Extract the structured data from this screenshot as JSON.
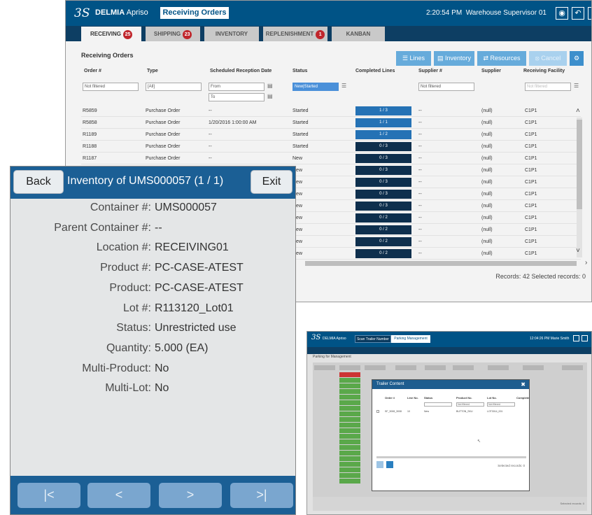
{
  "receiving": {
    "app": {
      "logo": "3S",
      "brand_bold": "DELMIA",
      "brand_rest": " Apriso",
      "page_tab": "Receiving Orders",
      "time": "2:20:54 PM",
      "user": "Warehouse Supervisor 01"
    },
    "tabs": [
      {
        "label": "RECEIVING",
        "badge": "25",
        "active": true
      },
      {
        "label": "SHIPPING",
        "badge": "23",
        "active": false
      },
      {
        "label": "INVENTORY",
        "badge": "",
        "active": false
      },
      {
        "label": "REPLENISHMENT",
        "badge": "1",
        "active": false
      },
      {
        "label": "KANBAN",
        "badge": "",
        "active": false
      }
    ],
    "title": "Receiving Orders",
    "toolbar": {
      "lines": "Lines",
      "inventory": "Inventory",
      "resources": "Resources",
      "cancel": "Cancel"
    },
    "columns": [
      "Order #",
      "Type",
      "Scheduled Reception Date",
      "Status",
      "Completed Lines",
      "Supplier #",
      "Supplier",
      "Receiving Facility"
    ],
    "filters": {
      "order": "Not filtered",
      "type": "[All]",
      "from": "From",
      "to": "To",
      "status": "New|Started",
      "supplier_no": "Not filtered",
      "facility": "Not filtered"
    },
    "rows": [
      {
        "order": "R5859",
        "type": "Purchase Order",
        "date": "--",
        "status": "Started",
        "lines": "1 / 3",
        "supplier_no": "--",
        "supplier": "(null)",
        "facility": "C1P1"
      },
      {
        "order": "R5858",
        "type": "Purchase Order",
        "date": "1/20/2016 1:00:00 AM",
        "status": "Started",
        "lines": "1 / 1",
        "supplier_no": "--",
        "supplier": "(null)",
        "facility": "C1P1"
      },
      {
        "order": "R1189",
        "type": "Purchase Order",
        "date": "--",
        "status": "Started",
        "lines": "1 / 2",
        "supplier_no": "--",
        "supplier": "(null)",
        "facility": "C1P1"
      },
      {
        "order": "R1188",
        "type": "Purchase Order",
        "date": "--",
        "status": "Started",
        "lines": "0 / 3",
        "supplier_no": "--",
        "supplier": "(null)",
        "facility": "C1P1"
      },
      {
        "order": "R1187",
        "type": "Purchase Order",
        "date": "--",
        "status": "New",
        "lines": "0 / 3",
        "supplier_no": "--",
        "supplier": "(null)",
        "facility": "C1P1"
      },
      {
        "order": "",
        "type": "",
        "date": "",
        "status": "New",
        "lines": "0 / 3",
        "supplier_no": "--",
        "supplier": "(null)",
        "facility": "C1P1"
      },
      {
        "order": "",
        "type": "",
        "date": "",
        "status": "New",
        "lines": "0 / 3",
        "supplier_no": "--",
        "supplier": "(null)",
        "facility": "C1P1"
      },
      {
        "order": "",
        "type": "",
        "date": "",
        "status": "New",
        "lines": "0 / 3",
        "supplier_no": "--",
        "supplier": "(null)",
        "facility": "C1P1"
      },
      {
        "order": "",
        "type": "",
        "date": "",
        "status": "New",
        "lines": "0 / 3",
        "supplier_no": "--",
        "supplier": "(null)",
        "facility": "C1P1"
      },
      {
        "order": "",
        "type": "",
        "date": "",
        "status": "New",
        "lines": "0 / 2",
        "supplier_no": "--",
        "supplier": "(null)",
        "facility": "C1P1"
      },
      {
        "order": "",
        "type": "",
        "date": "",
        "status": "New",
        "lines": "0 / 2",
        "supplier_no": "--",
        "supplier": "(null)",
        "facility": "C1P1"
      },
      {
        "order": "",
        "type": "",
        "date": "",
        "status": "New",
        "lines": "0 / 2",
        "supplier_no": "--",
        "supplier": "(null)",
        "facility": "C1P1"
      },
      {
        "order": "",
        "type": "",
        "date": "",
        "status": "New",
        "lines": "0 / 2",
        "supplier_no": "--",
        "supplier": "(null)",
        "facility": "C1P1"
      }
    ],
    "records": "Records: 42  Selected records: 0"
  },
  "inventory": {
    "back": "Back",
    "exit": "Exit",
    "title": "Inventory of UMS000057 (1 / 1)",
    "fields": [
      {
        "label": "Container #:",
        "value": "UMS000057"
      },
      {
        "label": "Parent Container #:",
        "value": "--"
      },
      {
        "label": "Location #:",
        "value": "RECEIVING01"
      },
      {
        "label": "Product #:",
        "value": "PC-CASE-ATEST"
      },
      {
        "label": "Product:",
        "value": "PC-CASE-ATEST"
      },
      {
        "label": "Lot #:",
        "value": "R113120_Lot01"
      },
      {
        "label": "Status:",
        "value": "Unrestricted use"
      },
      {
        "label": "Quantity:",
        "value": "5.000 (EA)"
      },
      {
        "label": "Multi-Product:",
        "value": "No"
      },
      {
        "label": "Multi-Lot:",
        "value": "No"
      }
    ],
    "nav": {
      "first": "|<",
      "prev": "<",
      "next": ">",
      "last": ">|"
    }
  },
  "trailer": {
    "brand": "DELMIA Apriso",
    "crumb1": "Scan Trailer Number",
    "crumb2": "Parking Management",
    "time": "12:04:26 PM  Marie Smith",
    "page_title": "Parking for Management",
    "modal_title": "Trailer Content",
    "modal_columns": [
      "Order #",
      "Line No.",
      "Status",
      "Product No.",
      "Lot No.",
      "Complete"
    ],
    "modal_filter": "Not filtered",
    "modal_row": {
      "order": "SF_3008_3008",
      "line": "10",
      "status": "New",
      "product": "BUTTON_SKU",
      "lot": "LOT3014_001"
    },
    "modal_records": "Selected records: 0",
    "footer_records": "Selected records: 0"
  },
  "colors": {
    "header_blue": "#005386",
    "dark_bar": "#0d3e63",
    "progress_dark": "#0e2f4d",
    "progress_light": "#2572b5",
    "badge_red": "#c0262c",
    "status_green": "#5aa84a"
  }
}
